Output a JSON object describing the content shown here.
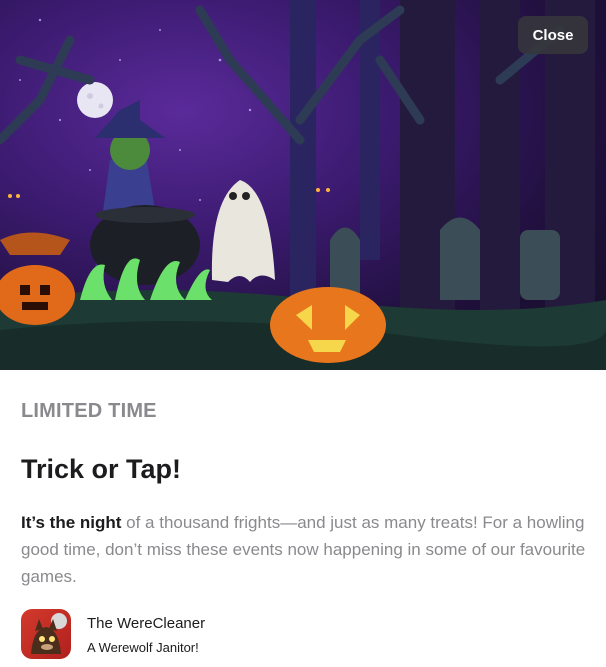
{
  "header": {
    "close_label": "Close"
  },
  "story": {
    "eyebrow": "LIMITED TIME",
    "title": "Trick or Tap!",
    "body_lead": "It’s the night",
    "body_rest": " of a thousand frights—and just as many treats! For a howling good time, don’t miss these events now happening in some of our favourite games."
  },
  "app": {
    "name": "The WereCleaner",
    "subtitle": "A Werewolf Janitor!"
  },
  "colors": {
    "sky": "#3a1a6e",
    "eyebrow": "#8a8a8e",
    "text": "#1c1c1e",
    "app_icon": "#d33a2c"
  }
}
